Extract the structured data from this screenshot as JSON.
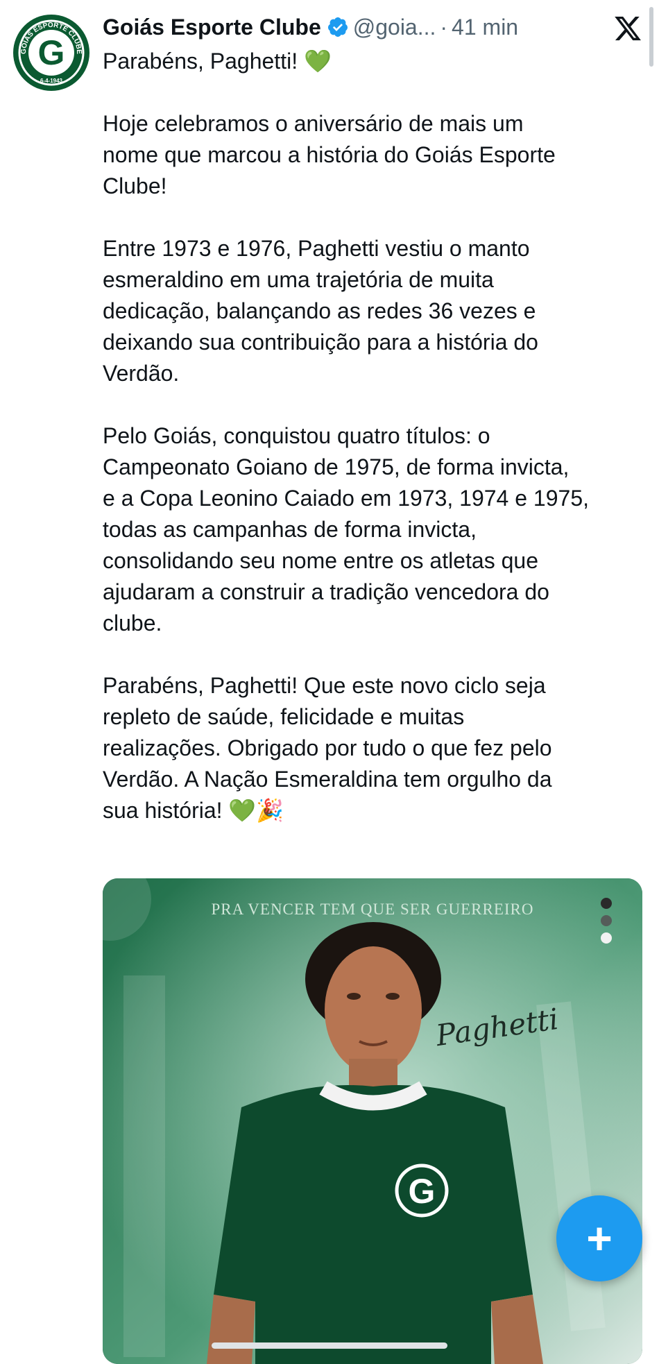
{
  "author": {
    "name": "Goiás Esporte Clube",
    "handle": "@goia...",
    "separator": "·",
    "time": "41 min",
    "verified": true,
    "avatar_text": "GOIÁS ESPORTE CLUBE",
    "avatar_date": "6-4-1943",
    "avatar_letter": "G"
  },
  "tweet": {
    "paragraphs": [
      "Parabéns, Paghetti!",
      "Hoje celebramos o aniversário de mais um\nnome que marcou a história do Goiás Esporte\nClube!",
      "Entre 1973 e 1976, Paghetti vestiu o manto\nesmeraldino em uma trajetória de muita\ndedicação, balançando as redes 36 vezes e\ndeixando sua contribuição para a história do\nVerdão.",
      "Pelo Goiás, conquistou quatro títulos: o\nCampeonato Goiano de 1975, de forma invicta,\ne a Copa Leonino Caiado em 1973, 1974 e 1975,\ntodas as campanhas de forma invicta,\nconsolidando seu nome entre os atletas que\najudaram a construir a tradição vencedora do\nclube.",
      "Parabéns, Paghetti! Que este novo ciclo seja\nrepleto de saúde, felicidade e muitas\nrealizações. Obrigado por tudo o que fez pelo\nVerdão. A Nação Esmeraldina tem orgulho da\nsua história!"
    ],
    "emoji_heart": "💚",
    "emoji_party": "🎉"
  },
  "media": {
    "tagline": "PRA VENCER TEM QUE SER GUERREIRO",
    "signature": "Paghetti",
    "shirt_letter": "G",
    "carousel_count": 3,
    "carousel_active": 3
  },
  "ui": {
    "fab_label": "+",
    "colors": {
      "brand_green": "#0b5a31",
      "verified_blue": "#1d9bf0",
      "fab_blue": "#1d9bf0",
      "muted_text": "#536471"
    }
  },
  "icons": {
    "verified": "verified-badge-icon",
    "x_logo": "x-logo-icon",
    "fab": "plus-icon"
  }
}
